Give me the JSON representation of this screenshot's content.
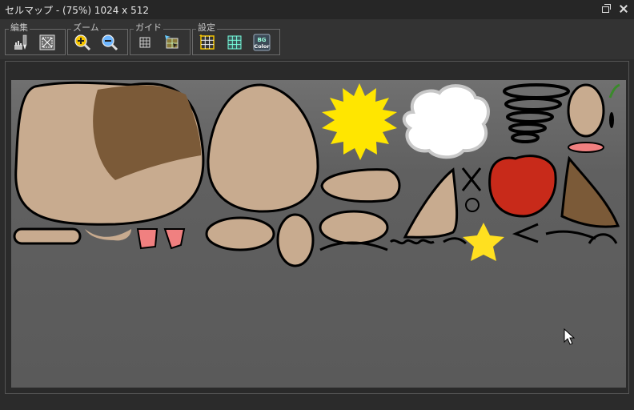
{
  "window": {
    "title": "セルマップ - (75%) 1024 x 512",
    "restore_icon": "restore-icon",
    "close_icon": "close-icon"
  },
  "toolbar": {
    "groups": [
      {
        "label": "編集",
        "buttons": [
          "brush-icon",
          "select-region-icon"
        ]
      },
      {
        "label": "ズーム",
        "buttons": [
          "zoom-in-icon",
          "zoom-out-icon"
        ]
      },
      {
        "label": "ガイド",
        "buttons": [
          "grid-small-icon",
          "move-guide-icon"
        ]
      },
      {
        "label": "設定",
        "buttons": [
          "grid-settings-icon",
          "grid-color-icon",
          "bg-color-icon"
        ]
      }
    ],
    "bg_color_button_line1": "BG",
    "bg_color_button_line2": "Color"
  },
  "canvas": {
    "background_colors": [
      "#707070",
      "#5a5a5a"
    ],
    "parts": [
      "head-shape",
      "hair-piece",
      "face-oval",
      "sun-burst",
      "cloud",
      "spiral-spring",
      "small-oval-ear",
      "nose-piece",
      "mouth-red",
      "tongue",
      "arm-bar",
      "star-yellow",
      "hair-triangle",
      "eyebrow-strokes",
      "apple-red"
    ]
  },
  "colors": {
    "skin": "#c8ab8f",
    "brown": "#7b5a38",
    "sun": "#ffe600",
    "red": "#c82a1a",
    "pink": "#f08080",
    "star": "#ffe020"
  }
}
